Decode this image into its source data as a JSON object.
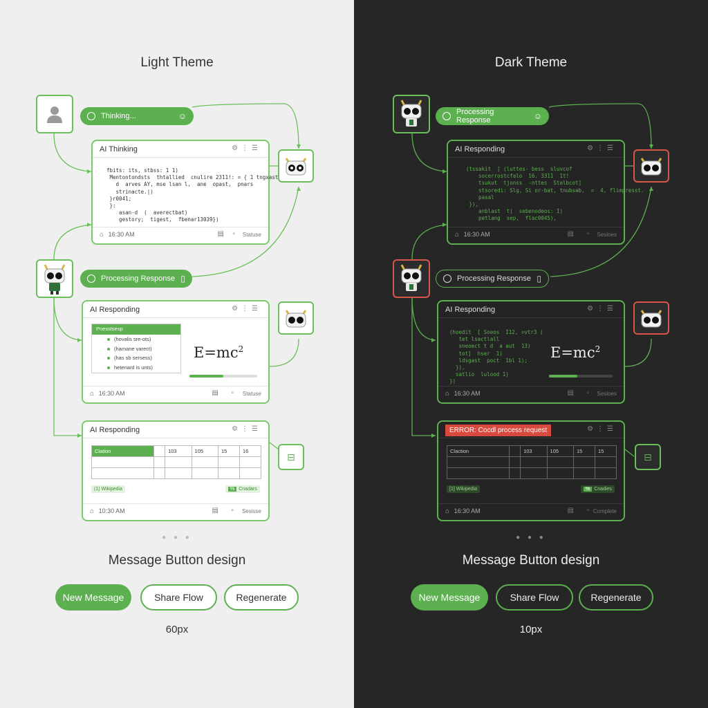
{
  "light": {
    "title": "Light Theme",
    "pill_thinking": "Thinking...",
    "pill_processing": "Processing Response",
    "card1": {
      "title": "AI Thinking",
      "code": "fbits: its, stbss: 1 1)\n Mentontondsts  thtallied  cnulire 2311!: = { 1 tngxast,\n   d  arves AY, mse lsan l,  ane  opast,  pnars\n   strinacte.|)\n }r0041;\n }:\n    asan-d  (  averectbat)\n    gestory;  tigest,  fbenar13039})",
      "time": "16:30 AM",
      "status": "Statuse"
    },
    "card2": {
      "title": "AI Responding",
      "list_header": "Pnesstsesp",
      "list_items": [
        "(hovalis sre-ots)",
        "(hamane varect)",
        "(has sb sersess)",
        "hetenard is unts)"
      ],
      "eq_main": "E=mc",
      "eq_sup": "2",
      "progress": 0.5,
      "time": "16:30 AM",
      "status": "Statuse"
    },
    "card3": {
      "title": "AI Responding",
      "table_header": [
        "Clation",
        "",
        "103",
        "105",
        "15",
        "16"
      ],
      "tag_left": "(1)  Wikipedia",
      "tag_left_b": "[1]",
      "tag_right": "Cnadars",
      "tag_right_b": "%",
      "time": "10:30 AM",
      "status": "Sesisse"
    },
    "subtitle": "Message Button design",
    "buttons": [
      "New Message",
      "Share Flow",
      "Regenerate"
    ],
    "caption": "60px",
    "dots": "● ● ●"
  },
  "dark": {
    "title": "Dark Theme",
    "pill_processing_top": "Processing Response",
    "pill_processing": "Processing Response",
    "card1": {
      "title": "AI Responding",
      "code": "(tssakit  [ (luttes- bess  sluvcof\n    socerrostcfalo  16. 3311  1t!\n    tsukut  tjonss  -nttes  Stelbcot]\n    stsoredi: Slg, Si or-bat, tnubsab,  =  4, flimpresst.\n    pasal\n }),\n    anblast  t(  sebenodeos: I)\n    petlang  sep,  flac0045),",
      "time": "16:30 AM",
      "status": "Sesloes"
    },
    "card2": {
      "title": "AI Responding",
      "code": "(hoedit  [ Soeos  I12, =vtr3 (\n   tet lsactlall\n   sneoect t d  a aut  13)\n   tot]  hser  1)\n   ldsgast  poct  1bl 1);\n  }),\n  satlio  lulood 1)\n})",
      "eq_main": "E=mc",
      "eq_sup": "2",
      "progress": 0.45,
      "time": "16:30 AM",
      "status": "Sesloes"
    },
    "card3": {
      "error": "ERROR: Cocdl process request",
      "table_header": [
        "Claction",
        "",
        "103",
        "105",
        "15",
        "15"
      ],
      "tag_left": "[1]  Wikipedia",
      "tag_left_b": "[1]",
      "tag_right": "Cnadies",
      "tag_right_b": "%",
      "time": "16:30 AM",
      "status": "Complete"
    },
    "subtitle": "Message Button design",
    "buttons": [
      "New Message",
      "Share Flow",
      "Regenerate"
    ],
    "caption": "10px",
    "dots": "● ● ●"
  },
  "colors": {
    "accent": "#5cb04f",
    "error": "#d84a3e",
    "light_bg": "#efefef",
    "dark_bg": "#262626"
  }
}
